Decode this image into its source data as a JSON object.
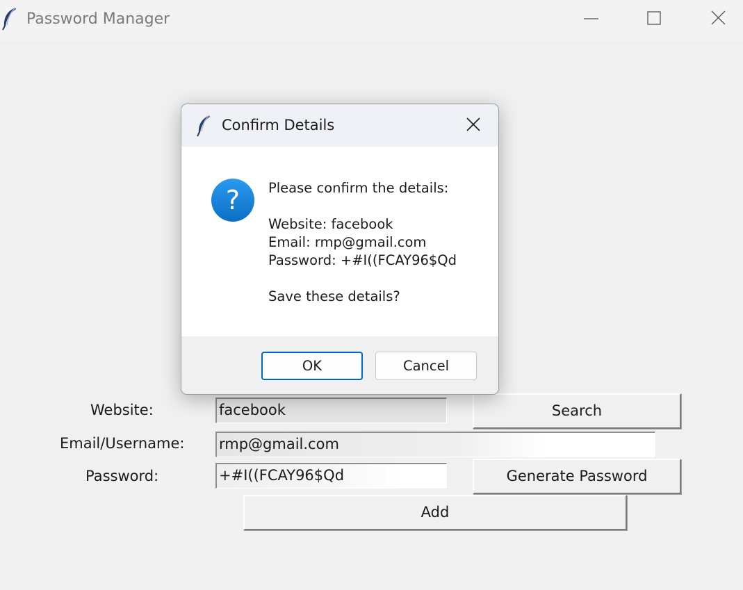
{
  "window": {
    "title": "Password Manager",
    "icons": {
      "app": "feather-icon",
      "minimize": "minimize-icon",
      "maximize": "maximize-icon",
      "close": "close-icon"
    }
  },
  "form": {
    "website_label": "Website:",
    "email_label": "Email/Username:",
    "password_label": "Password:",
    "website_value": "facebook",
    "email_value": "rmp@gmail.com",
    "password_value": "+#I((FCAY96$Qd",
    "search_button": "Search",
    "generate_button": "Generate Password",
    "add_button": "Add"
  },
  "dialog": {
    "title": "Confirm Details",
    "icon": "question-icon",
    "message_lines": [
      "Please confirm the details:",
      "",
      "Website: facebook",
      "Email: rmp@gmail.com",
      "Password: +#I((FCAY96$Qd",
      "",
      "Save these details?"
    ],
    "ok_button": "OK",
    "cancel_button": "Cancel"
  },
  "colors": {
    "background": "#f0f0f0",
    "dialog_title_bar": "#eff1f6",
    "question_icon": "#1a86d9",
    "ok_border": "#0067c0"
  }
}
